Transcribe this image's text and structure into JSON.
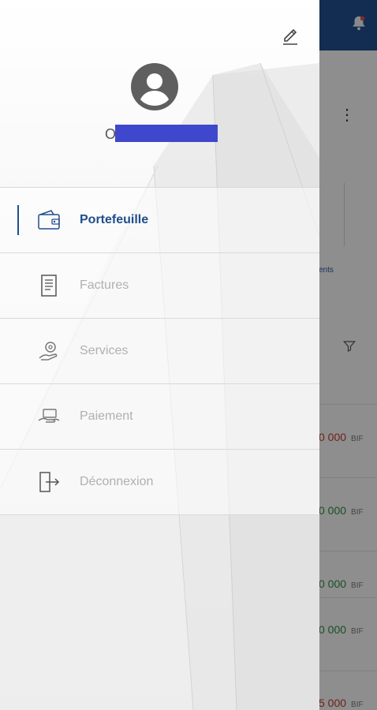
{
  "drawer": {
    "user": {
      "name_visible": "O"
    },
    "menu": [
      {
        "label": "Portefeuille",
        "active": true,
        "icon": "wallet-icon"
      },
      {
        "label": "Factures",
        "active": false,
        "icon": "invoice-icon"
      },
      {
        "label": "Services",
        "active": false,
        "icon": "services-icon"
      },
      {
        "label": "Paiement",
        "active": false,
        "icon": "payment-icon"
      },
      {
        "label": "Déconnexion",
        "active": false,
        "icon": "logout-icon"
      }
    ]
  },
  "background": {
    "link_fragment": "ents",
    "currency": "BIF",
    "amounts": [
      {
        "value": "0 000",
        "status": "negative"
      },
      {
        "value": "0 000",
        "status": "positive"
      },
      {
        "value": "0 000",
        "status": "positive"
      },
      {
        "value": "0 000",
        "status": "positive"
      },
      {
        "value": "5 000",
        "status": "negative"
      }
    ]
  },
  "colors": {
    "primary": "#1f4e8c",
    "negative": "#c0392b",
    "positive": "#2e8b3e",
    "inactive": "#b0b0b0",
    "redaction": "#3f48cc"
  }
}
